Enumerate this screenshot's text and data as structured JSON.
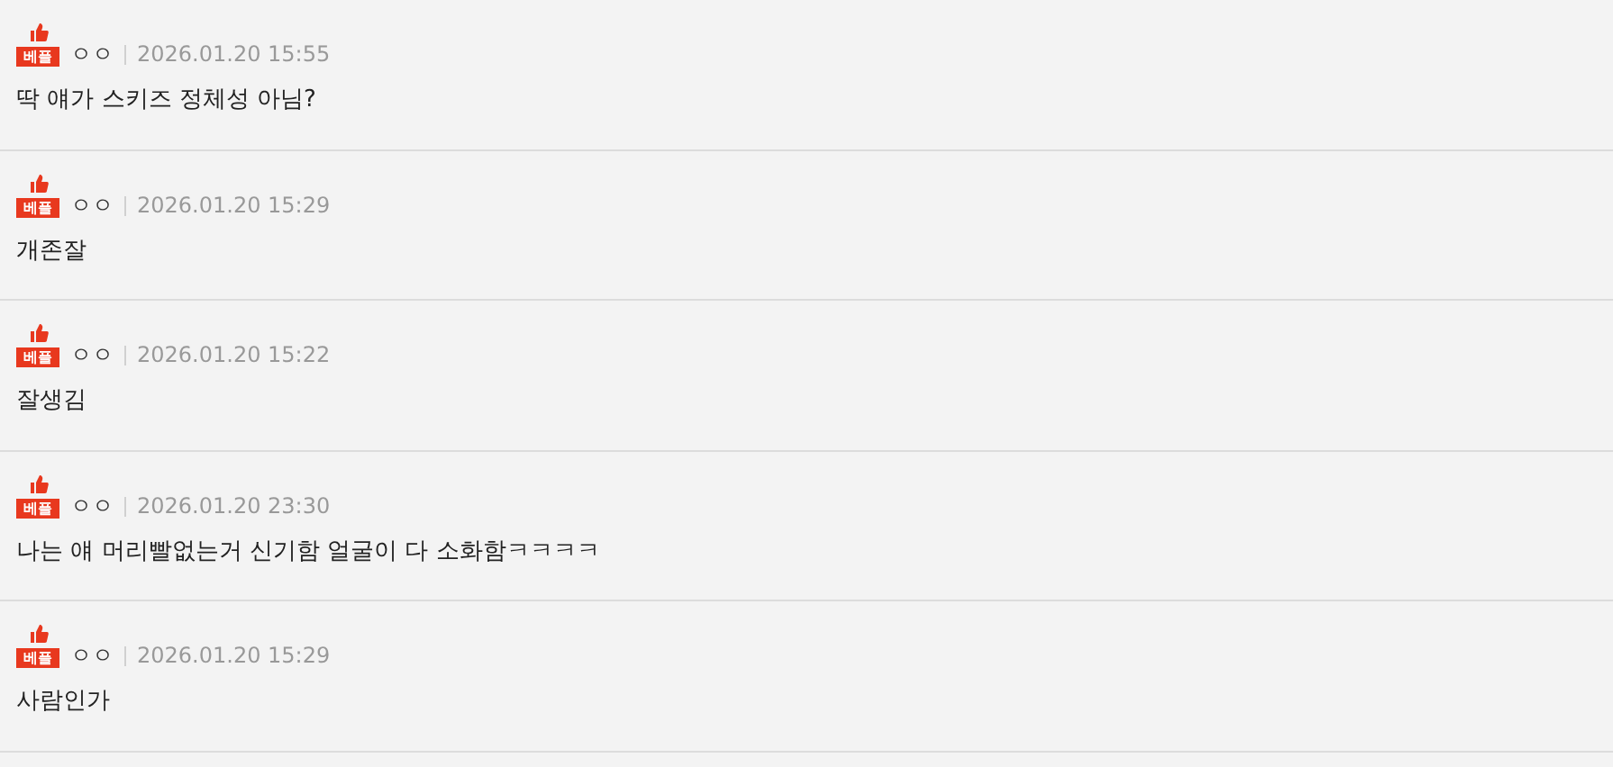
{
  "comments": [
    {
      "badge": "베플",
      "author": "ㅇㅇ",
      "date": "2026.01.20 15:55",
      "text": "딱 얘가 스키즈 정체성 아님?"
    },
    {
      "badge": "베플",
      "author": "ㅇㅇ",
      "date": "2026.01.20 15:29",
      "text": "개존잘"
    },
    {
      "badge": "베플",
      "author": "ㅇㅇ",
      "date": "2026.01.20 15:22",
      "text": "잘생김"
    },
    {
      "badge": "베플",
      "author": "ㅇㅇ",
      "date": "2026.01.20 23:30",
      "text": "나는 얘 머리빨없는거 신기함 얼굴이 다 소화함ㅋㅋㅋㅋ"
    },
    {
      "badge": "베플",
      "author": "ㅇㅇ",
      "date": "2026.01.20 15:29",
      "text": "사람인가"
    }
  ]
}
